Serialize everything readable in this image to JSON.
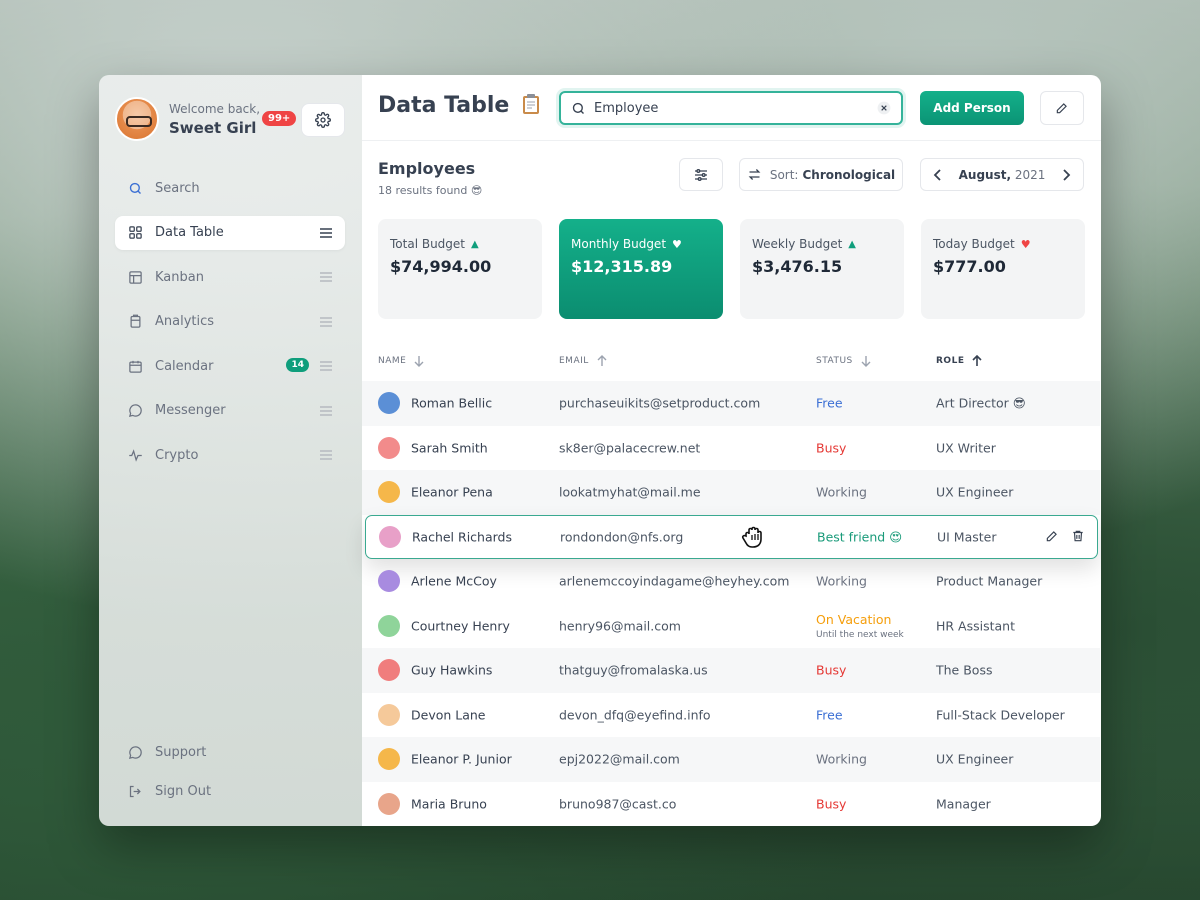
{
  "sidebar": {
    "welcome": "Welcome back,",
    "username": "Sweet Girl",
    "notif_count": "99+",
    "nav": [
      {
        "label": "Search",
        "icon": "search-icon"
      },
      {
        "label": "Data Table",
        "icon": "grid-icon",
        "active": true
      },
      {
        "label": "Kanban",
        "icon": "kanban-icon"
      },
      {
        "label": "Analytics",
        "icon": "clipboard-icon"
      },
      {
        "label": "Calendar",
        "icon": "calendar-icon",
        "badge": "14"
      },
      {
        "label": "Messenger",
        "icon": "chat-icon"
      },
      {
        "label": "Crypto",
        "icon": "pulse-icon"
      }
    ],
    "bottom": [
      {
        "label": "Support",
        "icon": "chat-icon"
      },
      {
        "label": "Sign Out",
        "icon": "sign-out-icon"
      }
    ]
  },
  "header": {
    "title": "Data Table",
    "search_value": "Employee",
    "add_label": "Add Person"
  },
  "section": {
    "title": "Employees",
    "subtitle": "18 results found 😎",
    "sort_prefix": "Sort:",
    "sort_value": "Chronological",
    "month": "August,",
    "year": "2021"
  },
  "cards": [
    {
      "label": "Total Budget",
      "value": "$74,994.00",
      "marker": "▲",
      "marker_color": "#0f9e7c"
    },
    {
      "label": "Monthly Budget",
      "value": "$12,315.89",
      "marker": "♥",
      "marker_color": "#ffffff"
    },
    {
      "label": "Weekly Budget",
      "value": "$3,476.15",
      "marker": "▲",
      "marker_color": "#0f9e7c"
    },
    {
      "label": "Today Budget",
      "value": "$777.00",
      "marker": "♥",
      "marker_color": "#ef4444"
    }
  ],
  "table": {
    "columns": [
      "NAME",
      "EMAIL",
      "STATUS",
      "ROLE"
    ],
    "rows": [
      {
        "name": "Roman Bellic",
        "email": "purchaseuikits@setproduct.com",
        "status": "Free",
        "role": "Art Director 😎",
        "avatar": "#5b8fd6"
      },
      {
        "name": "Sarah Smith",
        "email": "sk8er@palacecrew.net",
        "status": "Busy",
        "role": "UX Writer",
        "avatar": "#f28b8b"
      },
      {
        "name": "Eleanor Pena",
        "email": "lookatmyhat@mail.me",
        "status": "Working",
        "role": "UX Engineer",
        "avatar": "#f5b74a"
      },
      {
        "name": "Rachel Richards",
        "email": "rondondon@nfs.org",
        "status": "Best friend 😍",
        "role": "UI Master",
        "avatar": "#e8a0c8"
      },
      {
        "name": "Arlene McCoy",
        "email": "arlenemccoyindagame@heyhey.com",
        "status": "Working",
        "role": "Product Manager",
        "avatar": "#a88be0"
      },
      {
        "name": "Courtney Henry",
        "email": "henry96@mail.com",
        "status": "On Vacation",
        "status_note": "Until the next week",
        "role": "HR Assistant",
        "avatar": "#8fd49a"
      },
      {
        "name": "Guy Hawkins",
        "email": "thatguy@fromalaska.us",
        "status": "Busy",
        "role": "The Boss",
        "avatar": "#f07d7d"
      },
      {
        "name": "Devon Lane",
        "email": "devon_dfq@eyefind.info",
        "status": "Free",
        "role": "Full-Stack Developer",
        "avatar": "#f5c99a"
      },
      {
        "name": "Eleanor P. Junior",
        "email": "epj2022@mail.com",
        "status": "Working",
        "role": "UX Engineer",
        "avatar": "#f5b74a"
      },
      {
        "name": "Maria Bruno",
        "email": "bruno987@cast.co",
        "status": "Busy",
        "role": "Manager",
        "avatar": "#e8a58a"
      }
    ]
  }
}
